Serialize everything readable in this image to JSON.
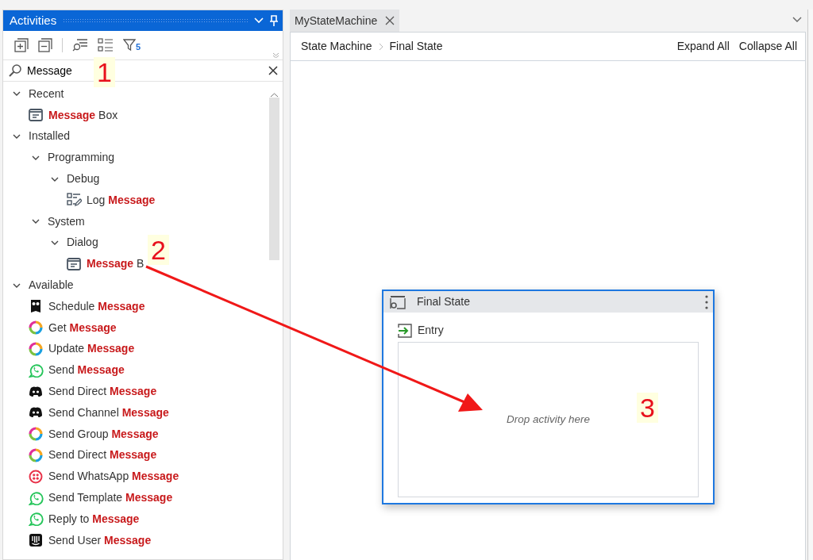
{
  "activities_panel": {
    "title": "Activities",
    "toolbar": {
      "filter_count": "5"
    },
    "search": {
      "value": "Message"
    },
    "tree": [
      {
        "kind": "group",
        "label": "Recent",
        "expanded": true,
        "children": [
          {
            "kind": "message-box",
            "label": "**Message** Box"
          }
        ]
      },
      {
        "kind": "group",
        "label": "Installed",
        "expanded": true,
        "children": [
          {
            "kind": "group",
            "label": "Programming",
            "expanded": true,
            "children": [
              {
                "kind": "group",
                "label": "Debug",
                "expanded": true,
                "children": [
                  {
                    "kind": "log",
                    "label": "Log **Message**"
                  }
                ]
              }
            ]
          },
          {
            "kind": "group",
            "label": "System",
            "expanded": true,
            "children": [
              {
                "kind": "group",
                "label": "Dialog",
                "expanded": true,
                "children": [
                  {
                    "kind": "message-box",
                    "label": "**Message** B"
                  }
                ]
              }
            ]
          }
        ]
      },
      {
        "kind": "group",
        "label": "Available",
        "expanded": true,
        "children": [
          {
            "kind": "owl",
            "label": "Schedule **Message**"
          },
          {
            "kind": "ring",
            "label": "Get **Message**"
          },
          {
            "kind": "ring",
            "label": "Update **Message**"
          },
          {
            "kind": "whatsapp",
            "label": "Send **Message**"
          },
          {
            "kind": "discord",
            "label": "Send Direct **Message**"
          },
          {
            "kind": "discord",
            "label": "Send Channel **Message**"
          },
          {
            "kind": "ring",
            "label": "Send Group **Message**"
          },
          {
            "kind": "ring",
            "label": "Send Direct **Message**"
          },
          {
            "kind": "twilio",
            "label": "Send WhatsApp **Message**"
          },
          {
            "kind": "whatsapp",
            "label": "Send Template **Message**"
          },
          {
            "kind": "whatsapp",
            "label": "Reply to **Message**"
          },
          {
            "kind": "intercom",
            "label": "Send User **Message**"
          }
        ]
      }
    ]
  },
  "editor": {
    "tabs": [
      {
        "label": "MyStateMachine",
        "selected": true
      }
    ],
    "breadcrumb": [
      "State Machine",
      "Final State"
    ],
    "actions": [
      "Expand All",
      "Collapse All"
    ],
    "state": {
      "title": "Final State",
      "section": "Entry",
      "placeholder": "Drop activity here"
    }
  },
  "annotations": [
    {
      "label": "1"
    },
    {
      "label": "2"
    },
    {
      "label": "3"
    }
  ]
}
